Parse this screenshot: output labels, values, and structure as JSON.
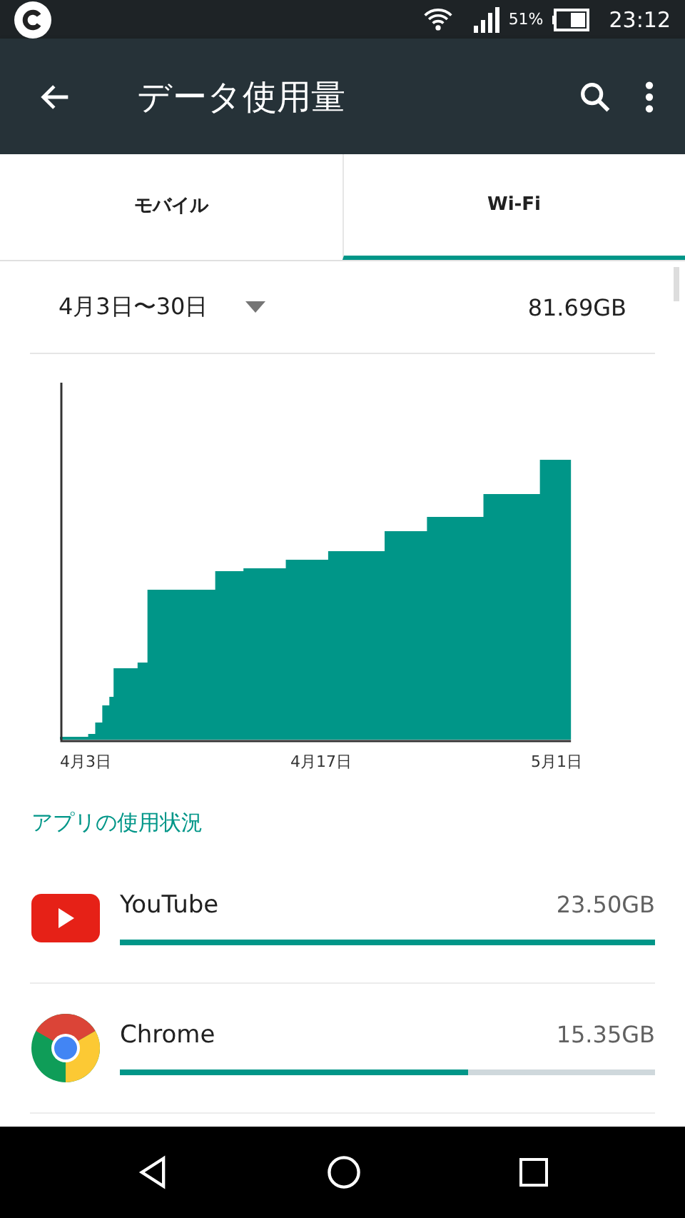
{
  "status_bar": {
    "battery": "51%",
    "time": "23:12"
  },
  "app_bar": {
    "title": "データ使用量"
  },
  "tabs": [
    {
      "label": "モバイル",
      "selected": false
    },
    {
      "label": "Wi-Fi",
      "selected": true
    }
  ],
  "period": {
    "range": "4月3日〜30日",
    "total": "81.69GB"
  },
  "graph": {
    "x_labels": [
      "4月3日",
      "4月17日",
      "5月1日"
    ]
  },
  "section_title": "アプリの使用状況",
  "apps": [
    {
      "kind": "youtube",
      "name": "YouTube",
      "usage": "23.50GB",
      "level": 1
    },
    {
      "kind": "chrome",
      "name": "Chrome",
      "usage": "15.35GB",
      "level": 0.65
    }
  ]
}
